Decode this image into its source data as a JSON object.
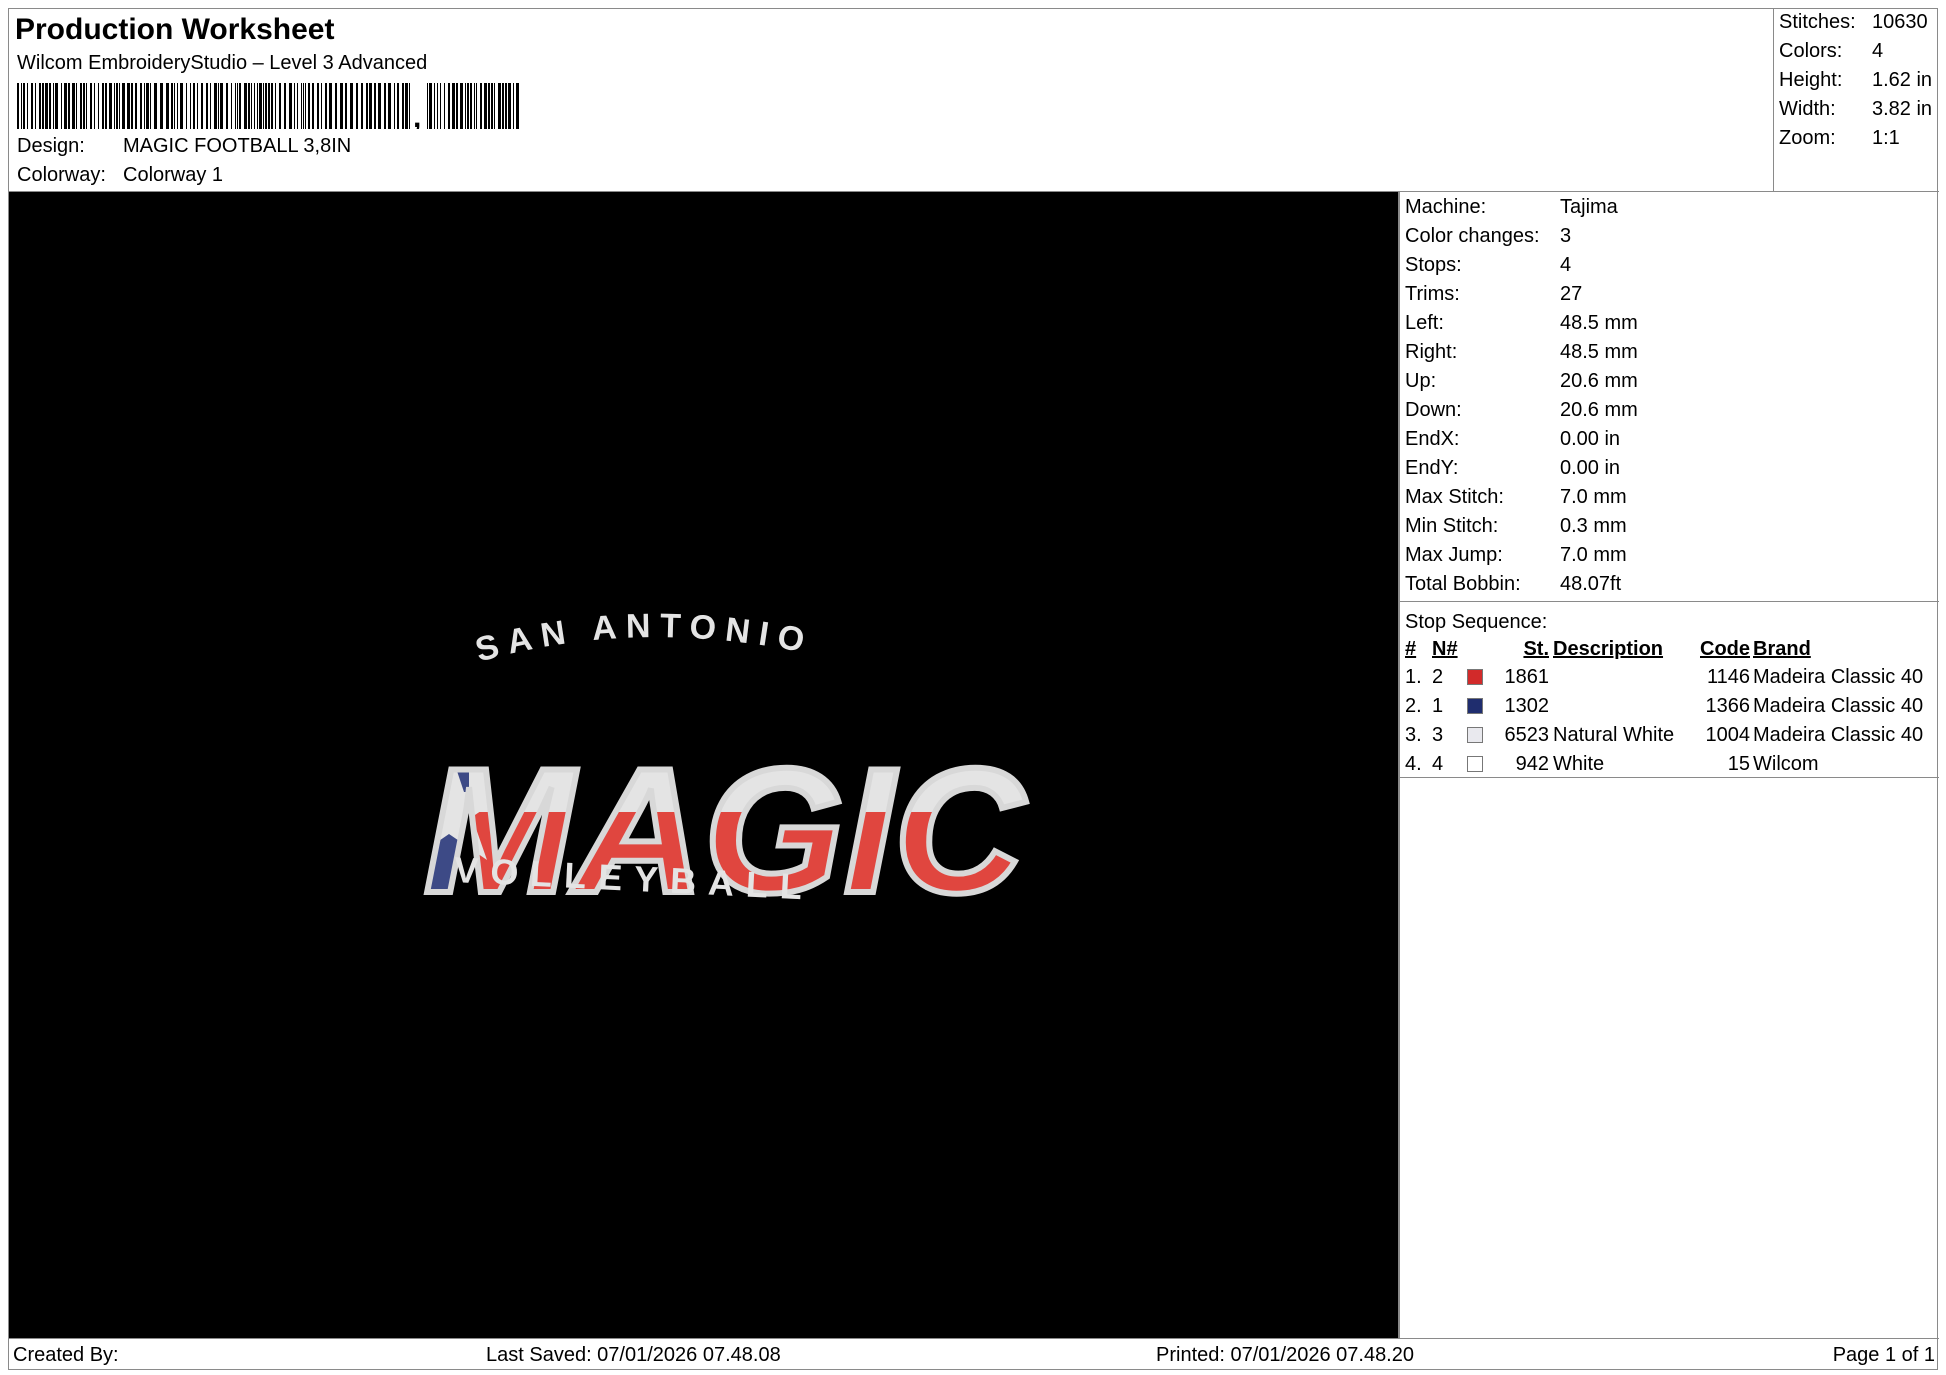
{
  "header": {
    "title": "Production Worksheet",
    "software": "Wilcom EmbroideryStudio – Level 3 Advanced",
    "design_label": "Design:",
    "design_value": "MAGIC FOOTBALL 3,8IN",
    "colorway_label": "Colorway:",
    "colorway_value": "Colorway 1"
  },
  "summary": [
    {
      "label": "Stitches:",
      "value": "10630"
    },
    {
      "label": "Colors:",
      "value": "4"
    },
    {
      "label": "Height:",
      "value": "1.62 in"
    },
    {
      "label": "Width:",
      "value": "3.82 in"
    },
    {
      "label": "Zoom:",
      "value": "1:1"
    }
  ],
  "design_preview": {
    "top_text": "SAN ANTONIO",
    "main_text": "MAGIC",
    "bottom_text": "VOLLEYBALL",
    "colors": {
      "red": "#e0463f",
      "blue": "#3d4a86",
      "white": "#e4e4e4",
      "outline": "#d8d8d8",
      "background": "#000000"
    }
  },
  "machine_stats": [
    {
      "label": "Machine:",
      "value": "Tajima"
    },
    {
      "label": "Color changes:",
      "value": "3"
    },
    {
      "label": "Stops:",
      "value": "4"
    },
    {
      "label": "Trims:",
      "value": "27"
    },
    {
      "label": "Left:",
      "value": "48.5 mm"
    },
    {
      "label": "Right:",
      "value": "48.5 mm"
    },
    {
      "label": "Up:",
      "value": "20.6 mm"
    },
    {
      "label": "Down:",
      "value": "20.6 mm"
    },
    {
      "label": "EndX:",
      "value": "0.00 in"
    },
    {
      "label": "EndY:",
      "value": "0.00 in"
    },
    {
      "label": "Max Stitch:",
      "value": "7.0 mm"
    },
    {
      "label": "Min Stitch:",
      "value": "0.3 mm"
    },
    {
      "label": "Max Jump:",
      "value": "7.0 mm"
    },
    {
      "label": "Total Bobbin:",
      "value": "48.07ft"
    }
  ],
  "stop_sequence": {
    "title": "Stop Sequence:",
    "headers": {
      "num": "#",
      "n": "N#",
      "st": "St.",
      "description": "Description",
      "code": "Code",
      "brand": "Brand"
    },
    "rows": [
      {
        "num": "1.",
        "n": "2",
        "swatch": "#d22a2a",
        "st": "1861",
        "description": "",
        "code": "1146",
        "brand": "Madeira Classic 40"
      },
      {
        "num": "2.",
        "n": "1",
        "swatch": "#1f2d6e",
        "st": "1302",
        "description": "",
        "code": "1366",
        "brand": "Madeira Classic 40"
      },
      {
        "num": "3.",
        "n": "3",
        "swatch": "#e9e9ee",
        "st": "6523",
        "description": "Natural White",
        "code": "1004",
        "brand": "Madeira Classic 40"
      },
      {
        "num": "4.",
        "n": "4",
        "swatch": "#ffffff",
        "st": "942",
        "description": "White",
        "code": "15",
        "brand": "Wilcom"
      }
    ]
  },
  "footer": {
    "created_by": "Created By:",
    "last_saved": "Last Saved: 07/01/2026 07.48.08",
    "printed": "Printed: 07/01/2026 07.48.20",
    "page": "Page 1 of 1"
  }
}
